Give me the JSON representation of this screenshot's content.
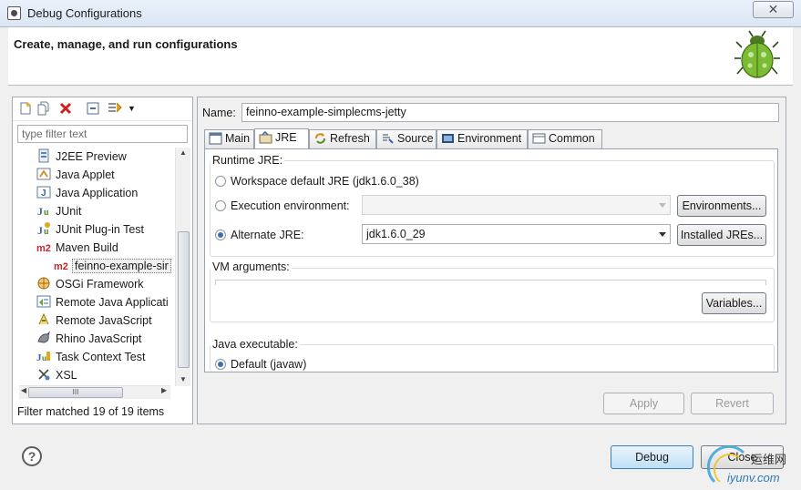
{
  "window": {
    "title": "Debug Configurations",
    "close_glyph": "✕"
  },
  "header": {
    "heading": "Create, manage, and run configurations"
  },
  "left": {
    "filter_placeholder": "type filter text",
    "tree": [
      {
        "label": "J2EE Preview",
        "icon": "j2ee-preview-icon"
      },
      {
        "label": "Java Applet",
        "icon": "java-applet-icon"
      },
      {
        "label": "Java Application",
        "icon": "java-application-icon"
      },
      {
        "label": "JUnit",
        "icon": "junit-icon"
      },
      {
        "label": "JUnit Plug-in Test",
        "icon": "junit-plugin-test-icon"
      },
      {
        "label": "Maven Build",
        "icon": "maven-build-icon"
      },
      {
        "label": "feinno-example-sir",
        "icon": "maven-config-icon"
      },
      {
        "label": "OSGi Framework",
        "icon": "osgi-framework-icon"
      },
      {
        "label": "Remote Java Applicati",
        "icon": "remote-java-application-icon"
      },
      {
        "label": "Remote JavaScript",
        "icon": "remote-javascript-icon"
      },
      {
        "label": "Rhino JavaScript",
        "icon": "rhino-javascript-icon"
      },
      {
        "label": "Task Context Test",
        "icon": "task-context-test-icon"
      },
      {
        "label": "XSL",
        "icon": "xsl-icon"
      }
    ],
    "hscroll_grip": "III",
    "status": "Filter matched 19 of 19 items"
  },
  "right": {
    "name_label": "Name:",
    "name_value": "feinno-example-simplecms-jetty",
    "tabs": [
      {
        "label": "Main",
        "icon": "main-tab-icon"
      },
      {
        "label": "JRE",
        "icon": "jre-tab-icon",
        "active": true
      },
      {
        "label": "Refresh",
        "icon": "refresh-tab-icon"
      },
      {
        "label": "Source",
        "icon": "source-tab-icon"
      },
      {
        "label": "Environment",
        "icon": "environment-tab-icon"
      },
      {
        "label": "Common",
        "icon": "common-tab-icon"
      }
    ],
    "runtime_jre": {
      "label": "Runtime JRE:",
      "workspace_default": "Workspace default JRE (jdk1.6.0_38)",
      "execution_env": "Execution environment:",
      "execution_env_value": "",
      "environments_btn": "Environments...",
      "alternate": "Alternate JRE:",
      "alternate_value": "jdk1.6.0_29",
      "installed_btn": "Installed JREs..."
    },
    "vm_args": {
      "label": "VM arguments:",
      "variables_btn": "Variables..."
    },
    "java_exec": {
      "label": "Java executable:",
      "default": "Default (javaw)"
    },
    "apply_btn": "Apply",
    "revert_btn": "Revert"
  },
  "footer": {
    "help": "?",
    "debug_btn": "Debug",
    "close_btn": "Close"
  },
  "watermark": {
    "text1": "运维网",
    "text2": "iyunv.com"
  },
  "colors": {
    "accent": "#3f6fa8",
    "selection": "#f0f0f0",
    "maven": "#c0282d"
  }
}
